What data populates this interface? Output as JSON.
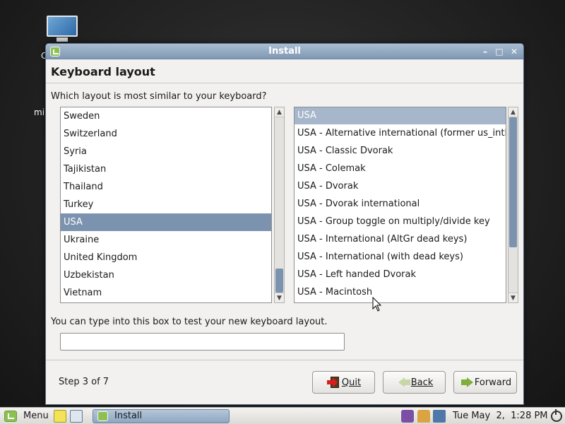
{
  "desktop": {
    "fragment_top": "C",
    "fragment_mid": "mi"
  },
  "window": {
    "title": "Install",
    "heading": "Keyboard layout",
    "question": "Which layout is most similar to your keyboard?",
    "countries": [
      "Sweden",
      "Switzerland",
      "Syria",
      "Tajikistan",
      "Thailand",
      "Turkey",
      "USA",
      "Ukraine",
      "United Kingdom",
      "Uzbekistan",
      "Vietnam"
    ],
    "countries_selected": "USA",
    "variants": [
      "USA",
      "USA - Alternative international (former us_intl)",
      "USA - Classic Dvorak",
      "USA - Colemak",
      "USA - Dvorak",
      "USA - Dvorak international",
      "USA - Group toggle on multiply/divide key",
      "USA - International (AltGr dead keys)",
      "USA - International (with dead keys)",
      "USA - Left handed Dvorak",
      "USA - Macintosh"
    ],
    "variants_selected": "USA",
    "test_label": "You can type into this box to test your new keyboard layout.",
    "test_value": "",
    "step": "Step 3 of 7",
    "buttons": {
      "quit": "Quit",
      "back": "Back",
      "forward": "Forward"
    }
  },
  "taskbar": {
    "menu_label": "Menu",
    "task_label": "Install",
    "clock": "Tue May  2,  1:28 PM",
    "icons": [
      "mint-menu-icon",
      "notes-icon",
      "terminal-icon",
      "settings-icon",
      "lock-icon",
      "network-icon",
      "power-icon"
    ]
  },
  "colors": {
    "selection": "#7c93b0",
    "titlebar": "#8fa6c0",
    "window_bg": "#f2f1ef"
  }
}
